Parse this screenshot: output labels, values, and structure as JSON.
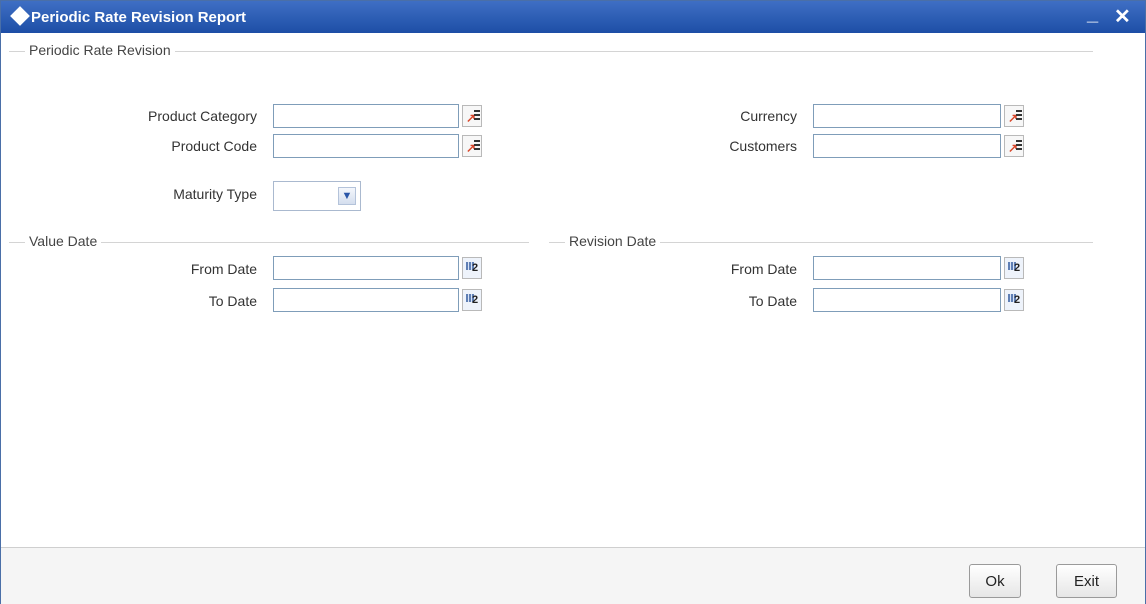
{
  "window": {
    "title": "Periodic Rate Revision Report",
    "minimize_glyph": "_",
    "close_glyph": "✕"
  },
  "icons": {
    "title": "diamond-icon",
    "lov": "list-of-values-icon",
    "calendar": "calendar-icon",
    "dropdown": "chevron-down-icon"
  },
  "periodic": {
    "section_label": "Periodic Rate Revision",
    "product_category": {
      "label": "Product Category",
      "value": ""
    },
    "product_code": {
      "label": "Product Code",
      "value": ""
    },
    "currency": {
      "label": "Currency",
      "value": ""
    },
    "customers": {
      "label": "Customers",
      "value": ""
    },
    "maturity_type": {
      "label": "Maturity Type",
      "value": ""
    }
  },
  "value_date": {
    "section_label": "Value Date",
    "from": {
      "label": "From Date",
      "value": ""
    },
    "to": {
      "label": "To Date",
      "value": ""
    }
  },
  "revision_date": {
    "section_label": "Revision Date",
    "from": {
      "label": "From Date",
      "value": ""
    },
    "to": {
      "label": "To Date",
      "value": ""
    }
  },
  "calendar_number": "2",
  "buttons": {
    "ok": "Ok",
    "exit": "Exit"
  }
}
